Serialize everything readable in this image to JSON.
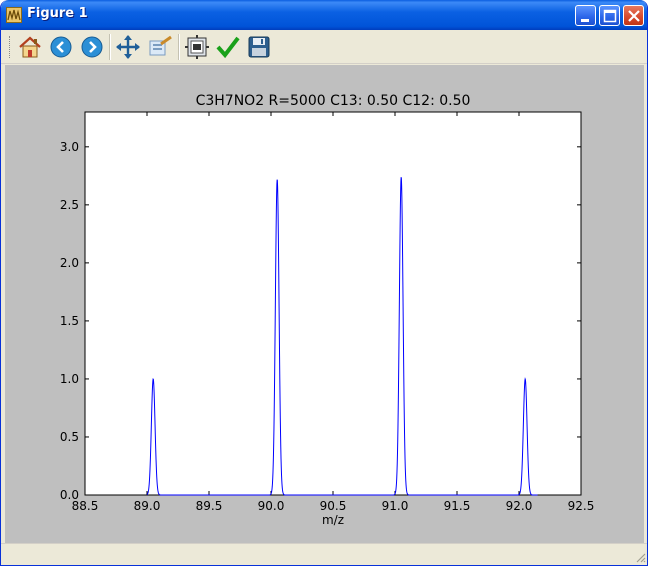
{
  "window": {
    "title": "Figure 1",
    "app_icon": "matplotlib-figure-icon",
    "controls": [
      "minimize-icon",
      "maximize-icon",
      "close-icon"
    ]
  },
  "toolbar": {
    "buttons": [
      {
        "name": "home-button",
        "icon": "home-icon"
      },
      {
        "name": "back-button",
        "icon": "back-arrow-icon"
      },
      {
        "name": "forward-button",
        "icon": "forward-arrow-icon"
      },
      {
        "name": "pan-button",
        "icon": "move-arrows-icon"
      },
      {
        "name": "zoom-button",
        "icon": "zoom-rect-icon"
      },
      {
        "name": "subplots-button",
        "icon": "subplots-config-icon"
      },
      {
        "name": "edit-button",
        "icon": "checkmark-icon"
      },
      {
        "name": "save-button",
        "icon": "floppy-disk-icon"
      }
    ]
  },
  "colors": {
    "line": "#0000ff",
    "figure_background": "#bfbfbf",
    "axes_background": "#ffffff"
  },
  "chart_data": {
    "type": "line",
    "title": "C3H7NO2 R=5000 C13: 0.50 C12: 0.50",
    "xlabel": "m/z",
    "ylabel": "",
    "xlim": [
      88.5,
      92.5
    ],
    "ylim": [
      0.0,
      3.3
    ],
    "xticks": [
      "88.5",
      "89.0",
      "89.5",
      "90.0",
      "90.5",
      "91.0",
      "91.5",
      "92.0",
      "92.5"
    ],
    "yticks": [
      "0.0",
      "0.5",
      "1.0",
      "1.5",
      "2.0",
      "2.5",
      "3.0"
    ],
    "grid": false,
    "series": [
      {
        "peaks": [
          {
            "x": 89.05,
            "y": 1.0
          },
          {
            "x": 90.05,
            "y": 2.72
          },
          {
            "x": 91.05,
            "y": 2.74
          },
          {
            "x": 92.05,
            "y": 1.0
          }
        ],
        "peak_width": 0.035,
        "baseline": 0.0,
        "x_range": [
          89.0,
          92.15
        ]
      }
    ]
  }
}
